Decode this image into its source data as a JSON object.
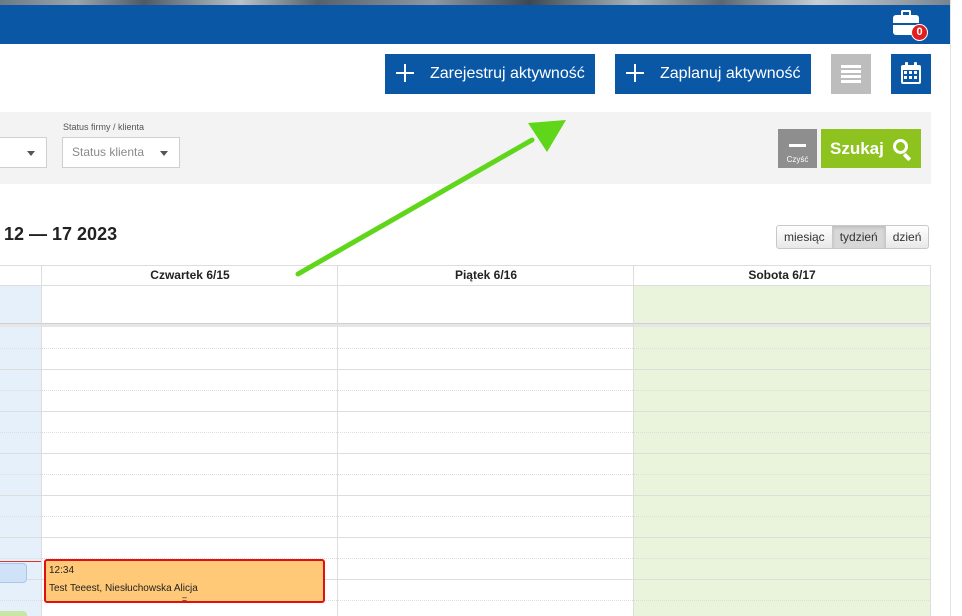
{
  "header": {
    "cart_count": "0"
  },
  "actions": {
    "register_label": "Zarejestruj aktywność",
    "plan_label": "Zaplanuj aktywność",
    "list_view_icon": "list-icon",
    "calendar_view_icon": "calendar-icon"
  },
  "filters": {
    "status_label": "Status firmy / klienta",
    "status_placeholder": "Status klienta",
    "clear_label": "Czyść",
    "search_label": "Szukaj"
  },
  "calendar": {
    "title": "12 — 17 2023",
    "views": [
      "miesiąc",
      "tydzień",
      "dzień"
    ],
    "active_view": "tydzień",
    "days": [
      "Czwartek 6/15",
      "Piątek 6/16",
      "Sobota 6/17"
    ],
    "event": {
      "time": "12:34",
      "title": "Test Teeest, Niesłuchowska Alicja",
      "grip": "="
    }
  },
  "colors": {
    "brand_blue": "#0a57a6",
    "search_green": "#8dc21f",
    "today_bg": "#e6f0fb",
    "weekend_bg": "#eaf4dd",
    "event_bg": "#ffc978",
    "event_border": "#e01010",
    "annotation_arrow": "#5fd61a"
  }
}
